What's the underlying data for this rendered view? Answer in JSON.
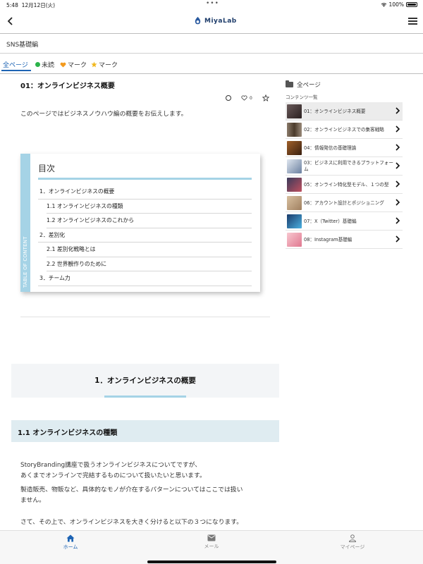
{
  "status": {
    "time": "5:48",
    "date": "12月12日(火)",
    "dots": "•••",
    "battery": "100%"
  },
  "header": {
    "logo_text": "MiyaLab"
  },
  "category": {
    "label": "SNS基礎編"
  },
  "filters": [
    {
      "label": "全ページ"
    },
    {
      "label": "未読"
    },
    {
      "label": "マーク"
    },
    {
      "label": "マーク"
    }
  ],
  "article": {
    "title": "01：オンラインビジネス概要",
    "like_count": "0",
    "intro": "このページではビジネスノウハウ編の概要をお伝えします。"
  },
  "toc": {
    "side_label": "TABLE OF CONTENT",
    "title": "目次",
    "items": [
      "1．オンラインビジネスの概要",
      "1.1 オンラインビジネスの種類",
      "1.2 オンラインビジネスのこれから",
      "2．差別化",
      "2.1 差別化戦略とは",
      "2.2 世界観作りのために",
      "3．チーム力"
    ]
  },
  "sections": {
    "h1": "1．オンラインビジネスの概要",
    "h2": "1.1 オンラインビジネスの種類",
    "p1_line1": "StoryBranding講座で扱うオンラインビジネスについてですが、",
    "p1_line2": "あくまでオンラインで完結するものについて扱いたいと思います。",
    "p2_line1": "製造販売、物販など、具体的なモノが介在するパターンについてはここでは扱い",
    "p2_line2": "ません。",
    "p3": "さて、その上で、オンラインビジネスを大きく分けると以下の３つになります。"
  },
  "sidebar": {
    "title": "全ページ",
    "subtitle": "コンテンツ一覧",
    "items": [
      {
        "label": "01：オンラインビジネス概要",
        "thumb_color": "#4a3b3a"
      },
      {
        "label": "02：オンラインビジネスでの集客戦略",
        "thumb_color": "#6b5a4a"
      },
      {
        "label": "04：情報発信の基礎理論",
        "thumb_color": "#7a4a2a"
      },
      {
        "label": "03：ビジネスに利用できるプラットフォーム",
        "thumb_color": "#8a9cb5"
      },
      {
        "label": "05：オンライン特化型モデル、１つの型",
        "thumb_color": "#3a3a5a"
      },
      {
        "label": "06：アカウント設計とポジショニング",
        "thumb_color": "#b89a78"
      },
      {
        "label": "07：X（Twitter）基礎編",
        "thumb_color": "#2a6fa8"
      },
      {
        "label": "08：Instagram基礎編",
        "thumb_color": "#e8a0b0"
      }
    ]
  },
  "bottomnav": {
    "home": "ホーム",
    "mail": "メール",
    "mypage": "マイページ"
  },
  "colors": {
    "accent": "#1e64b4",
    "toc_accent": "#a5d3e6",
    "unread_dot": "#2bb34a",
    "heart": "#f39a1e",
    "star": "#f1b81e"
  }
}
